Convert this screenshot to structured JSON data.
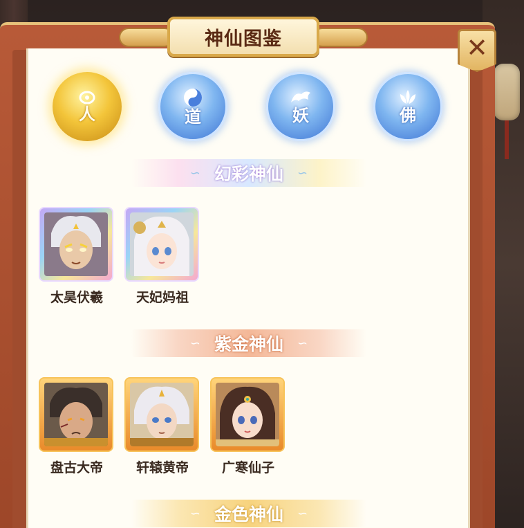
{
  "window": {
    "title": "神仙图鉴"
  },
  "close": {
    "label": "✕"
  },
  "tabs": [
    {
      "label": "人",
      "active": true
    },
    {
      "label": "道",
      "active": false
    },
    {
      "label": "妖",
      "active": false
    },
    {
      "label": "佛",
      "active": false
    }
  ],
  "sections": [
    {
      "title": "幻彩神仙",
      "heroes": [
        {
          "name": "太昊伏羲"
        },
        {
          "name": "天妃妈祖"
        }
      ]
    },
    {
      "title": "紫金神仙",
      "heroes": [
        {
          "name": "盘古大帝"
        },
        {
          "name": "轩辕黄帝"
        },
        {
          "name": "广寒仙子"
        }
      ]
    },
    {
      "title": "金色神仙",
      "heroes": []
    }
  ],
  "colors": {
    "panel": "#b85a38",
    "content_bg": "#fffdf5",
    "active_tab": "#f3c53a",
    "inactive_tab": "#3e74d4",
    "title_text": "#5a2a14"
  },
  "icons": {
    "close": "close-icon",
    "tab_ren": "person-icon",
    "tab_dao": "yin-yang-icon",
    "tab_yao": "fox-icon",
    "tab_fo": "lotus-icon"
  }
}
